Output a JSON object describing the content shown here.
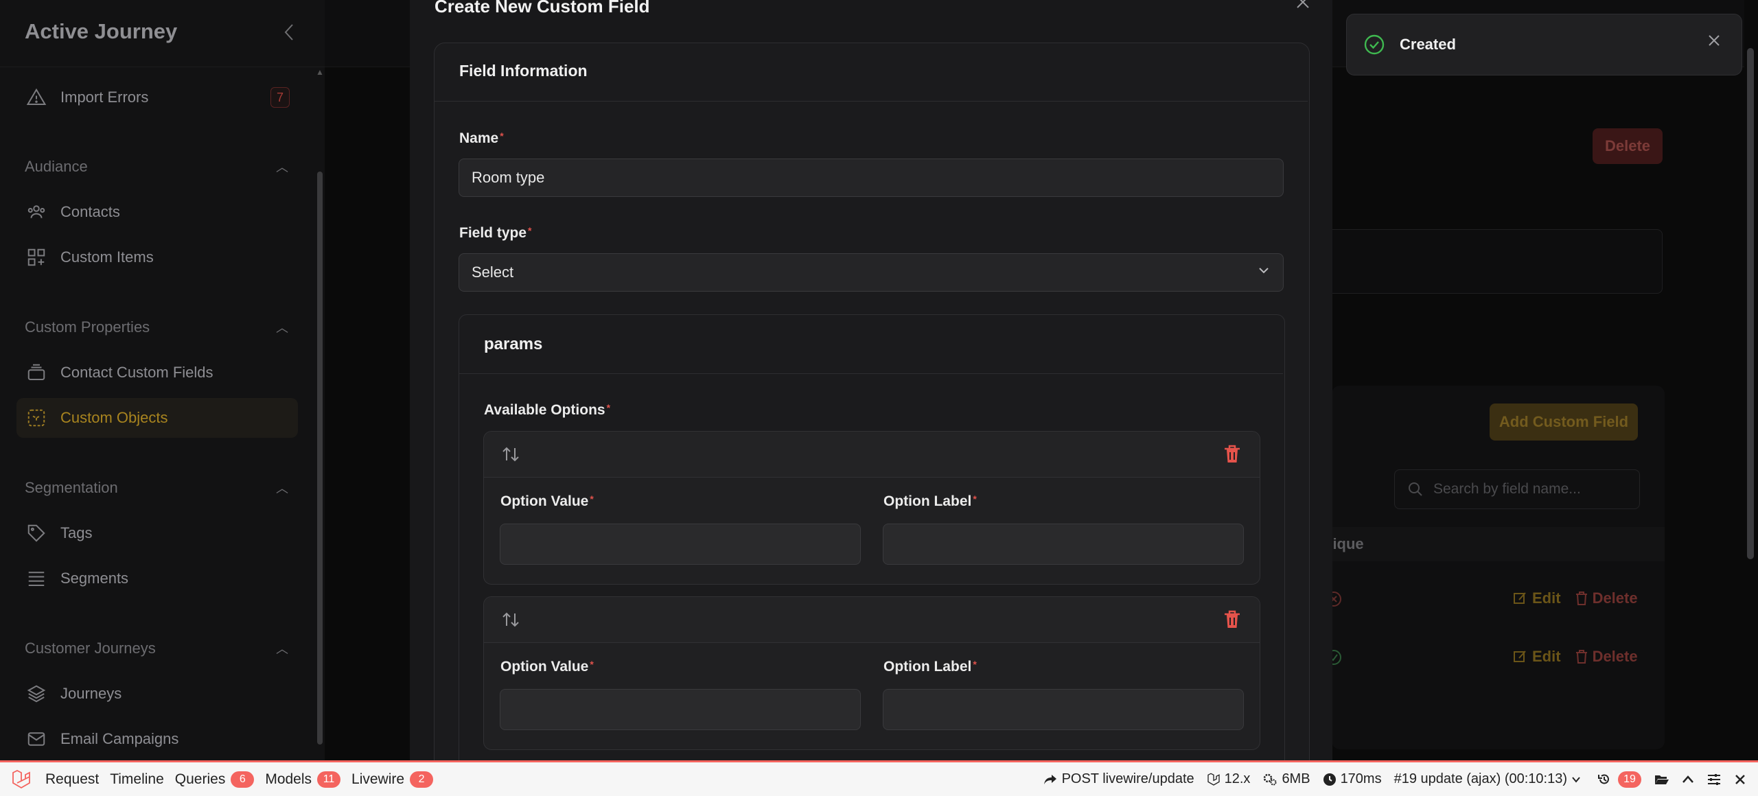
{
  "sidebar": {
    "brand": "Active Journey",
    "items": [
      {
        "label": "Import Errors",
        "badge": "7",
        "icon": "warning-icon"
      },
      {
        "label": "Contacts",
        "icon": "users-icon"
      },
      {
        "label": "Custom Items",
        "icon": "grid-plus-icon"
      },
      {
        "label": "Contact Custom Fields",
        "icon": "stack-icon"
      },
      {
        "label": "Custom Objects",
        "icon": "cube-dashed-icon",
        "active": true
      },
      {
        "label": "Tags",
        "icon": "tag-icon"
      },
      {
        "label": "Segments",
        "icon": "lines-icon"
      },
      {
        "label": "Journeys",
        "icon": "layers-icon"
      },
      {
        "label": "Email Campaigns",
        "icon": "envelope-icon"
      }
    ],
    "groups": [
      "Audiance",
      "Custom Properties",
      "Segmentation",
      "Customer Journeys"
    ]
  },
  "background": {
    "delete_label": "Delete",
    "add_custom_field_label": "Add Custom Field",
    "search_placeholder": "Search by field name...",
    "column_unique": "nique",
    "row_edit": "Edit",
    "row_delete": "Delete"
  },
  "modal": {
    "title": "Create New Custom Field",
    "section_title": "Field Information",
    "name_label": "Name",
    "name_value": "Room type",
    "field_type_label": "Field type",
    "field_type_value": "Select",
    "params_title": "params",
    "available_options_label": "Available Options",
    "option_value_label": "Option Value",
    "option_label_label": "Option Label",
    "required_mark": "*"
  },
  "toast": {
    "message": "Created"
  },
  "debugbar": {
    "tabs": [
      {
        "label": "Request"
      },
      {
        "label": "Timeline"
      },
      {
        "label": "Queries",
        "count": "6"
      },
      {
        "label": "Models",
        "count": "11"
      },
      {
        "label": "Livewire",
        "count": "2"
      }
    ],
    "route": "POST livewire/update",
    "laravel_version": "12.x",
    "memory": "6MB",
    "time": "170ms",
    "request": "#19 update (ajax) (00:10:13)",
    "history_count": "19"
  }
}
